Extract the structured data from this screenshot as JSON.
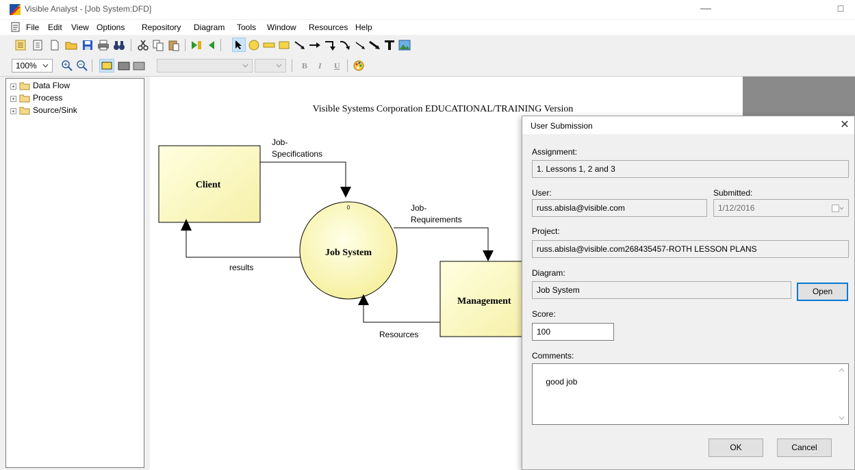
{
  "window": {
    "title": "Visible Analyst - [Job System:DFD]",
    "minimize_glyph": "—",
    "maximize_glyph": "☐"
  },
  "menu": [
    {
      "label": "File"
    },
    {
      "label": "Edit"
    },
    {
      "label": "View"
    },
    {
      "label": "Options"
    },
    {
      "label": "Repository"
    },
    {
      "label": "Diagram"
    },
    {
      "label": "Tools"
    },
    {
      "label": "Window"
    },
    {
      "label": "Resources"
    },
    {
      "label": "Help"
    }
  ],
  "toolbar2": {
    "zoom": "100%",
    "bold": "B",
    "italic": "I",
    "underline": "U"
  },
  "tree": {
    "items": [
      {
        "label": "Data Flow",
        "expander": "+"
      },
      {
        "label": "Process",
        "expander": "+"
      },
      {
        "label": "Source/Sink",
        "expander": "+"
      }
    ]
  },
  "diagram": {
    "banner": "Visible Systems Corporation EDUCATIONAL/TRAINING Version",
    "client_label": "Client",
    "process_label": "Job System",
    "process_number": "0",
    "management_label": "Management",
    "flow_job_spec_line1": "Job-",
    "flow_job_spec_line2": "Specifications",
    "flow_job_req_line1": "Job-",
    "flow_job_req_line2": "Requirements",
    "flow_results": "results",
    "flow_resources": "Resources",
    "entity_fill": "#ffffd0",
    "process_fill": "#ffffc0"
  },
  "dialog": {
    "title": "User Submission",
    "close_glyph": "✕",
    "assignment_label": "Assignment:",
    "assignment_value": "1. Lessons 1, 2 and 3",
    "user_label": "User:",
    "user_value": "russ.abisla@visible.com",
    "submitted_label": "Submitted:",
    "submitted_value": "1/12/2016",
    "project_label": "Project:",
    "project_value": "russ.abisla@visible.com268435457-ROTH LESSON PLANS",
    "diagram_label": "Diagram:",
    "diagram_value": "Job System",
    "open_label": "Open",
    "score_label": "Score:",
    "score_value": "100",
    "comments_label": "Comments:",
    "comments_value": "good job",
    "ok_label": "OK",
    "cancel_label": "Cancel",
    "accent": "#0078d7"
  }
}
